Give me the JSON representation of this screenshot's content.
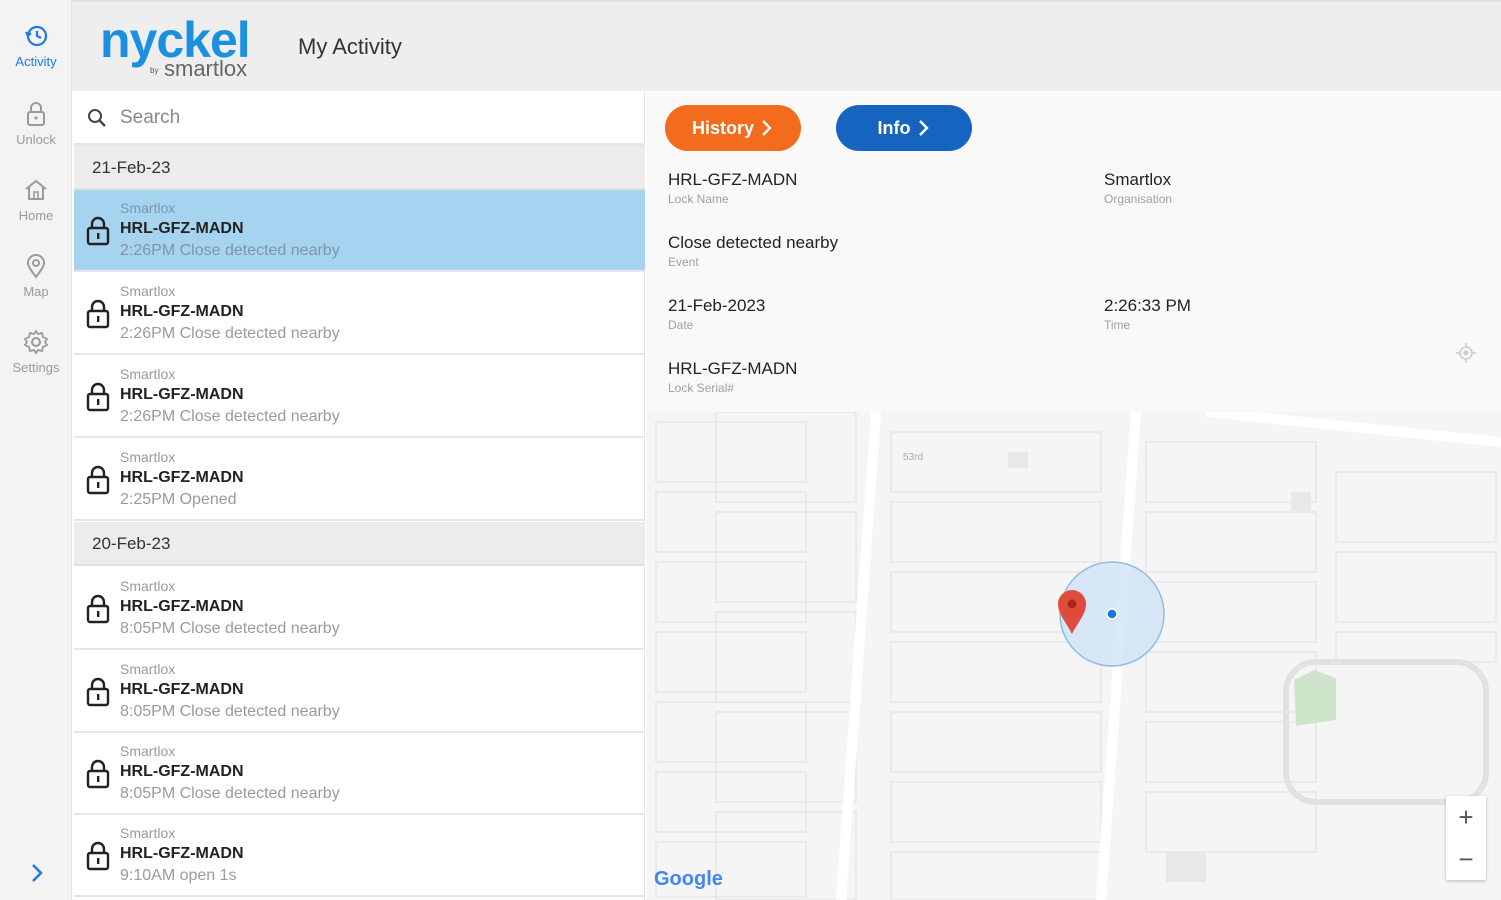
{
  "nav": {
    "items": [
      {
        "label": "Activity",
        "icon": "clock-history-icon",
        "active": true
      },
      {
        "label": "Unlock",
        "icon": "lock-icon",
        "active": false
      },
      {
        "label": "Home",
        "icon": "home-icon",
        "active": false
      },
      {
        "label": "Map",
        "icon": "map-pin-icon",
        "active": false
      },
      {
        "label": "Settings",
        "icon": "gear-icon",
        "active": false
      }
    ],
    "expand_icon": "chevron-right-icon"
  },
  "header": {
    "logo_main": "nyckel",
    "logo_by": "by",
    "logo_sub": "smartlox",
    "title": "My Activity"
  },
  "search": {
    "placeholder": "Search"
  },
  "groups": [
    {
      "date": "21-Feb-23",
      "entries": [
        {
          "org": "Smartlox",
          "name": "HRL-GFZ-MADN",
          "event": "2:26PM Close detected nearby",
          "selected": true
        },
        {
          "org": "Smartlox",
          "name": "HRL-GFZ-MADN",
          "event": "2:26PM Close detected nearby",
          "selected": false
        },
        {
          "org": "Smartlox",
          "name": "HRL-GFZ-MADN",
          "event": "2:26PM Close detected nearby",
          "selected": false
        },
        {
          "org": "Smartlox",
          "name": "HRL-GFZ-MADN",
          "event": "2:25PM Opened",
          "selected": false
        }
      ]
    },
    {
      "date": "20-Feb-23",
      "entries": [
        {
          "org": "Smartlox",
          "name": "HRL-GFZ-MADN",
          "event": "8:05PM Close detected nearby",
          "selected": false
        },
        {
          "org": "Smartlox",
          "name": "HRL-GFZ-MADN",
          "event": "8:05PM Close detected nearby",
          "selected": false
        },
        {
          "org": "Smartlox",
          "name": "HRL-GFZ-MADN",
          "event": "8:05PM Close detected nearby",
          "selected": false
        },
        {
          "org": "Smartlox",
          "name": "HRL-GFZ-MADN",
          "event": "9:10AM open 1s",
          "selected": false
        }
      ]
    }
  ],
  "detail": {
    "history_button": "History",
    "info_button": "Info",
    "lock_name": {
      "value": "HRL-GFZ-MADN",
      "label": "Lock Name"
    },
    "organisation": {
      "value": "Smartlox",
      "label": "Organisation"
    },
    "event": {
      "value": "Close detected nearby",
      "label": "Event"
    },
    "date": {
      "value": "21-Feb-2023",
      "label": "Date"
    },
    "time": {
      "value": "2:26:33 PM",
      "label": "Time"
    },
    "lock_serial": {
      "value": "HRL-GFZ-MADN",
      "label": "Lock Serial#"
    }
  },
  "map": {
    "attribution": "Google",
    "street_label": "53rd",
    "zoom_in": "+",
    "zoom_out": "−"
  },
  "colors": {
    "accent_blue": "#1d7ae8",
    "history_orange": "#f36b1c",
    "info_blue": "#1565c0",
    "selected_row": "#a6d3f0",
    "logo_blue": "#1b8fe0"
  }
}
